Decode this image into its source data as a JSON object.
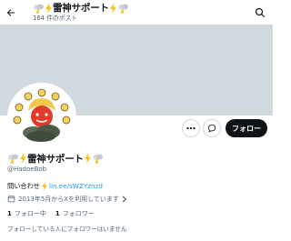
{
  "header": {
    "title": "雷神サポート",
    "post_count": "164 件のポスト",
    "back_icon": "back-arrow-icon",
    "search_icon": "search-icon"
  },
  "profile": {
    "display_name": "雷神サポート",
    "handle": "@HadoeBob",
    "bio_prefix": "問い合わせ",
    "bio_link": "lin.ee/sWZYznzd",
    "joined": "2013年5月からXを利用しています",
    "following_count": "1",
    "following_label": "フォロー中",
    "followers_count": "1",
    "followers_label": "フォロワー",
    "follower_notice": "フォローしている人にフォロワーはいません"
  },
  "actions": {
    "follow_label": "フォロー",
    "more_icon": "more-icon",
    "message_icon": "message-icon"
  },
  "colors": {
    "banner": "#cfd9de",
    "accent": "#1d9bf0",
    "text": "#0f1419",
    "muted": "#536471",
    "avatar_bg": "#ffffff",
    "lightning": "#f5c518"
  }
}
